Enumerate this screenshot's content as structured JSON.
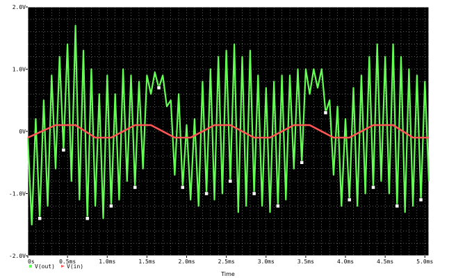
{
  "chart_data": {
    "type": "line",
    "xlabel": "Time",
    "ylabel": "",
    "xlim": [
      0,
      5.05
    ],
    "ylim": [
      -2.0,
      2.0
    ],
    "grid": true,
    "x_ticks": [
      0,
      0.5,
      1.0,
      1.5,
      2.0,
      2.5,
      3.0,
      3.5,
      4.0,
      4.5,
      5.0
    ],
    "x_tick_labels": [
      "0s",
      "0.5ms",
      "1.0ms",
      "1.5ms",
      "2.0ms",
      "2.5ms",
      "3.0ms",
      "3.5ms",
      "4.0ms",
      "4.5ms",
      "5.0ms"
    ],
    "y_ticks": [
      -2.0,
      -1.0,
      0,
      1.0,
      2.0
    ],
    "y_tick_labels": [
      "-2.0V",
      "-1.0V",
      "0V",
      "1.0V",
      "2.0V"
    ],
    "legend_position": "bottom-left",
    "colors": {
      "background": "#000000",
      "grid": "#ffffff",
      "frame": "#ffffff"
    },
    "series": [
      {
        "name": "V(out)",
        "color": "#66ff55",
        "marker": "square-white",
        "x": [
          0,
          0.05,
          0.1,
          0.15,
          0.2,
          0.25,
          0.3,
          0.35,
          0.4,
          0.45,
          0.5,
          0.55,
          0.6,
          0.65,
          0.7,
          0.75,
          0.8,
          0.85,
          0.9,
          0.95,
          1.0,
          1.05,
          1.1,
          1.15,
          1.2,
          1.25,
          1.3,
          1.35,
          1.4,
          1.45,
          1.5,
          1.55,
          1.6,
          1.65,
          1.7,
          1.75,
          1.8,
          1.85,
          1.9,
          1.95,
          2.0,
          2.05,
          2.1,
          2.15,
          2.2,
          2.25,
          2.3,
          2.35,
          2.4,
          2.45,
          2.5,
          2.55,
          2.6,
          2.65,
          2.7,
          2.75,
          2.8,
          2.85,
          2.9,
          2.95,
          3.0,
          3.05,
          3.1,
          3.15,
          3.2,
          3.25,
          3.3,
          3.35,
          3.4,
          3.45,
          3.5,
          3.55,
          3.6,
          3.65,
          3.7,
          3.75,
          3.8,
          3.85,
          3.9,
          3.95,
          4.0,
          4.05,
          4.1,
          4.15,
          4.2,
          4.25,
          4.3,
          4.35,
          4.4,
          4.45,
          4.5,
          4.55,
          4.6,
          4.65,
          4.7,
          4.75,
          4.8,
          4.85,
          4.9,
          4.95,
          5.0,
          5.05
        ],
        "values": [
          -0.1,
          -1.5,
          0.2,
          -1.4,
          0.5,
          -1.2,
          0.9,
          -0.6,
          1.2,
          -0.3,
          1.4,
          -0.8,
          1.7,
          -1.1,
          1.3,
          -1.4,
          1.0,
          -1.2,
          0.6,
          -1.4,
          0.9,
          -1.2,
          0.6,
          -1.1,
          1.0,
          -0.8,
          0.9,
          -0.9,
          0.8,
          -0.6,
          0.9,
          0.6,
          0.95,
          0.7,
          0.9,
          0.4,
          0.5,
          -0.7,
          0.6,
          -0.9,
          0.1,
          -1.1,
          0.2,
          -1.2,
          0.8,
          -1.0,
          1.0,
          -1.1,
          1.2,
          -1.0,
          1.3,
          -0.8,
          1.4,
          -1.3,
          1.2,
          -1.2,
          1.3,
          -1.0,
          0.9,
          -1.2,
          0.7,
          -1.3,
          0.8,
          -1.2,
          0.9,
          -1.1,
          0.9,
          -0.6,
          1.0,
          -0.5,
          1.0,
          0.6,
          1.0,
          0.7,
          1.0,
          0.3,
          0.5,
          -0.7,
          0.4,
          -1.2,
          0.2,
          -1.1,
          0.7,
          -1.2,
          0.9,
          -1.0,
          1.2,
          -0.9,
          1.4,
          -0.8,
          1.2,
          -1.0,
          1.4,
          -1.2,
          1.2,
          -1.3,
          1.0,
          -1.2,
          0.9,
          -1.1,
          0.8,
          -0.8
        ]
      },
      {
        "name": "V(in)",
        "color": "#ff5555",
        "marker": "none",
        "x": [
          0,
          0.35,
          0.6,
          0.85,
          1.05,
          1.35,
          1.55,
          1.85,
          2.05,
          2.35,
          2.55,
          2.85,
          3.05,
          3.35,
          3.55,
          3.85,
          4.05,
          4.35,
          4.6,
          4.85,
          5.05
        ],
        "values": [
          -0.1,
          0.1,
          0.1,
          -0.1,
          -0.1,
          0.1,
          0.1,
          -0.1,
          -0.1,
          0.1,
          0.1,
          -0.1,
          -0.1,
          0.1,
          0.1,
          -0.1,
          -0.1,
          0.1,
          0.1,
          -0.1,
          -0.1
        ]
      }
    ]
  }
}
